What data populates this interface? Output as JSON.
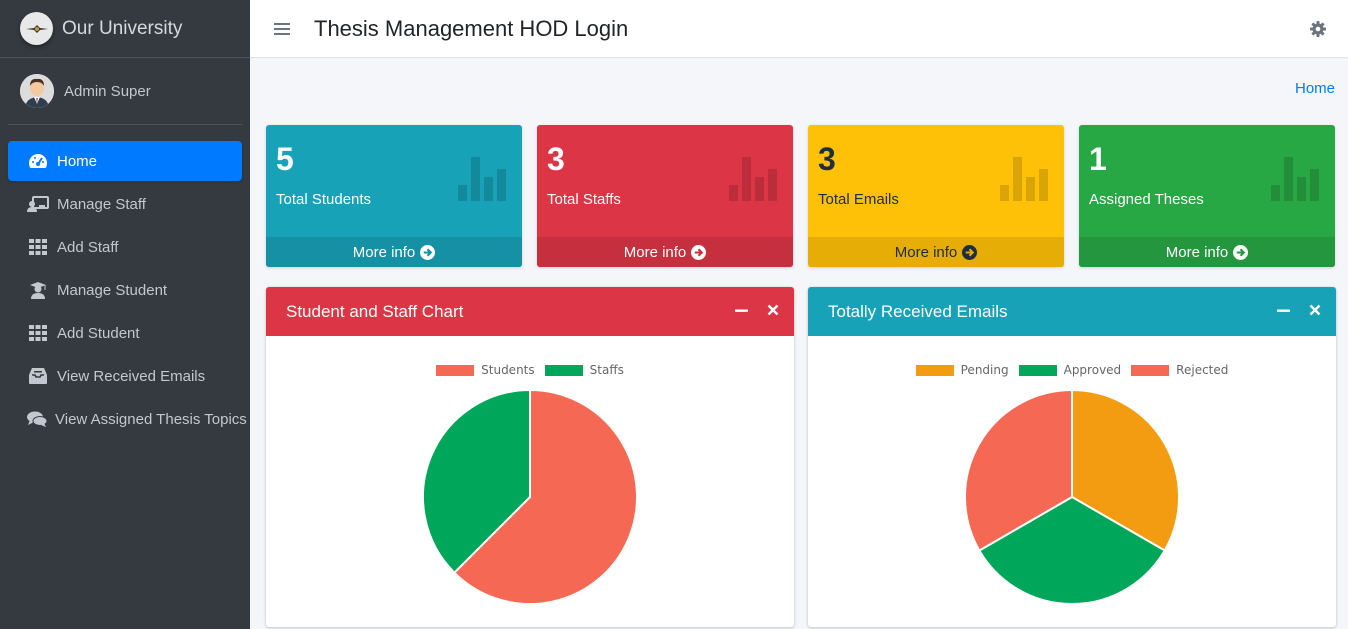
{
  "brand": {
    "name": "Our University"
  },
  "user": {
    "name": "Admin Super"
  },
  "sidebar": {
    "items": [
      {
        "label": "Home",
        "icon": "tachometer-icon",
        "active": true
      },
      {
        "label": "Manage Staff",
        "icon": "staff-icon"
      },
      {
        "label": "Add Staff",
        "icon": "grid-icon"
      },
      {
        "label": "Manage Student",
        "icon": "graduate-icon"
      },
      {
        "label": "Add Student",
        "icon": "grid-icon"
      },
      {
        "label": "View Received Emails",
        "icon": "inbox-icon"
      },
      {
        "label": "View Assigned Thesis Topics",
        "icon": "comments-icon"
      }
    ]
  },
  "header": {
    "title": "Thesis Management HOD Login"
  },
  "breadcrumb": {
    "home": "Home"
  },
  "stats": [
    {
      "value": "5",
      "label": "Total Students",
      "more": "More info",
      "color": "#17a2b8"
    },
    {
      "value": "3",
      "label": "Total Staffs",
      "more": "More info",
      "color": "#dc3545"
    },
    {
      "value": "3",
      "label": "Total Emails",
      "more": "More info",
      "color": "#ffc107"
    },
    {
      "value": "1",
      "label": "Assigned Theses",
      "more": "More info",
      "color": "#28a745"
    }
  ],
  "cards": [
    {
      "title": "Student and Staff Chart",
      "color": "#dc3545"
    },
    {
      "title": "Totally Received Emails",
      "color": "#17a2b8"
    }
  ],
  "chart_data": [
    {
      "type": "pie",
      "title": "Student and Staff Chart",
      "labels": [
        "Students",
        "Staffs"
      ],
      "values": [
        5,
        3
      ],
      "colors": [
        "#f56954",
        "#00a65a"
      ],
      "legend": "top"
    },
    {
      "type": "pie",
      "title": "Totally Received Emails",
      "labels": [
        "Pending",
        "Approved",
        "Rejected"
      ],
      "values": [
        1,
        1,
        1
      ],
      "colors": [
        "#f39c12",
        "#00a65a",
        "#f56954"
      ],
      "legend": "top"
    }
  ]
}
